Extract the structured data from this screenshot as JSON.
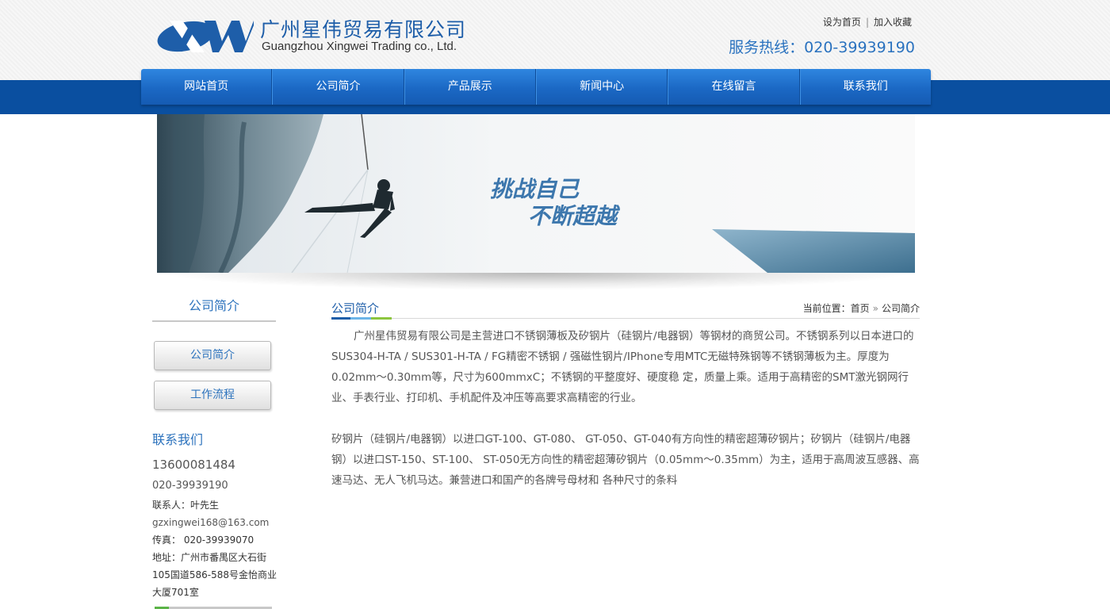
{
  "header": {
    "company_cn": "广州星伟贸易有限公司",
    "company_en": "Guangzhou Xingwei Trading co., Ltd.",
    "logo_letters": "XW",
    "top_links": [
      "设为首页",
      "加入收藏"
    ],
    "hotline": "服务热线：020-39939190"
  },
  "nav": {
    "items": [
      "网站首页",
      "公司简介",
      "产品展示",
      "新闻中心",
      "在线留言",
      "联系我们"
    ]
  },
  "banner": {
    "slogan_line1": "挑战自己",
    "slogan_line2": "不断超越"
  },
  "sidebar": {
    "title": "公司简介",
    "buttons": [
      "公司简介",
      "工作流程"
    ],
    "contact_title": "联系我们",
    "mobile": "13600081484",
    "tel": "020-39939190",
    "contact_person": "联系人：叶先生",
    "email": "gzxingwei168@163.com",
    "fax": "传真：  020-39939070",
    "address_lines": [
      "地址：广州市番禺区大石街",
      "105国道586-588号金怡商业",
      "大厦701室"
    ]
  },
  "content": {
    "title": "公司简介",
    "breadcrumb_prefix": "当前位置：",
    "breadcrumb_home": "首页",
    "breadcrumb_arrow": "»",
    "breadcrumb_current": "公司简介",
    "paragraph1": "广州星伟贸易有限公司是主营进口不锈钢薄板及矽钢片（硅钢片/电器钢）等钢材的商贸公司。不锈钢系列以日本进口的SUS304-H-TA / SUS301-H-TA / FG精密不锈钢 / 强磁性钢片/IPhone专用MTC无磁特殊钢等不锈钢薄板为主。厚度为0.02mm～0.30mm等，尺寸为600mmxC；不锈钢的平整度好、硬度稳 定，质量上乘。适用于高精密的SMT激光钢网行业、手表行业、打印机、手机配件及冲压等高要求高精密的行业。",
    "paragraph2": "矽钢片（硅钢片/电器钢）以进口GT-100、GT-080、 GT-050、GT-040有方向性的精密超薄矽钢片；矽钢片（硅钢片/电器钢）以进口ST-150、ST-100、 ST-050无方向性的精密超薄矽钢片（0.05mm～0.35mm）为主，适用于高周波互感器、高速马达、无人飞机马达。兼营进口和国产的各牌号母材和 各种尺寸的条料"
  },
  "colors": {
    "brand_blue": "#1e5ea9",
    "nav_blue": "#1b68c4",
    "band_blue": "#0a4fa0",
    "accent_green": "#8cc63e"
  }
}
